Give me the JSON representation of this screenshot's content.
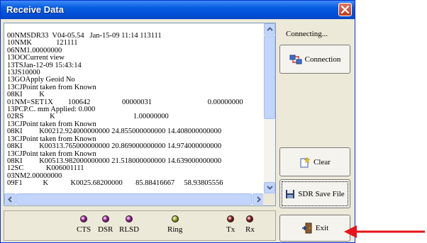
{
  "window": {
    "title": "Receive Data"
  },
  "log": {
    "lines": [
      "00NMSDR33  V04-05.54   Jan-15-09 11:14 113111",
      "10NMK             121111",
      "06NM1.00000000",
      "13OOCurrent view",
      "13TSJan-12-09 15:43:14",
      "13JS10000",
      "13GOApply Geoid No",
      "13CJPoint taken from Known",
      "08KI         K",
      "01NM=SET1X        100642                 00000031                              0.00000000",
      "13PCP.C. mm Applied: 0.000",
      "02RS              K                                          1.00000000",
      "13CJPoint taken from Known",
      "08KI         K00212.924000000000 24.855000000000 14.408000000000",
      "13CJPoint taken from Known",
      "08KI         K00313.765000000000 20.869000000000 14.974000000000",
      "13CJPoint taken from Known",
      "08KI         K00513.982000000000 21.518000000000 14.639000000000",
      "12SC            K006001111",
      "03NM2.00000000",
      "09F1           K            K0025.68200000       85.88416667     58.93805556"
    ]
  },
  "status": {
    "text": "Connecting..."
  },
  "buttons": {
    "connection": "Connection",
    "clear": "Clear",
    "sdr_save_file": "SDR Save File",
    "exit": "Exit"
  },
  "signals": [
    {
      "label": "CTS",
      "color": "#a2179b"
    },
    {
      "label": "DSR",
      "color": "#a2179b"
    },
    {
      "label": "RLSD",
      "color": "#a2179b"
    },
    {
      "label": "Ring",
      "color": "#9aa816"
    },
    {
      "label": "Tx",
      "color": "#8c1212"
    },
    {
      "label": "Rx",
      "color": "#8c1212"
    }
  ],
  "annotation": {
    "arrow_color": "#e8141b"
  }
}
